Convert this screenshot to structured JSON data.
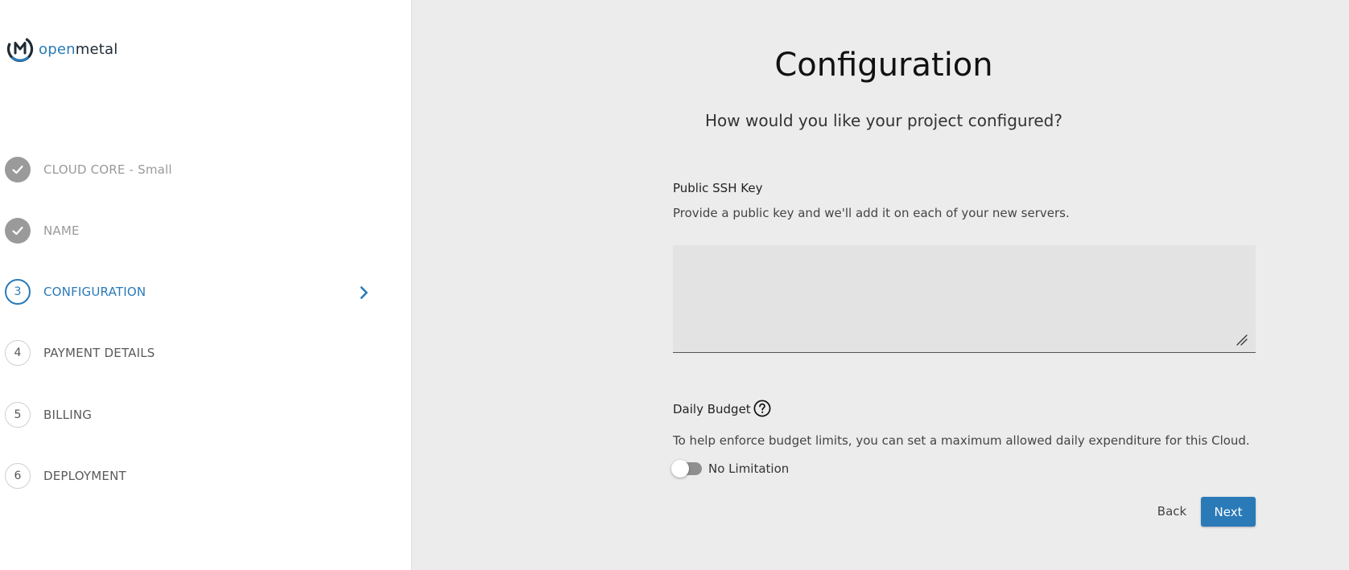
{
  "brand": {
    "logo_open": "open",
    "logo_metal": "metal",
    "accent_color": "#2a7ab8"
  },
  "steps": [
    {
      "number": "1",
      "label": "CLOUD CORE - Small",
      "state": "done",
      "icon": "check-icon"
    },
    {
      "number": "2",
      "label": "NAME",
      "state": "done",
      "icon": "check-icon"
    },
    {
      "number": "3",
      "label": "CONFIGURATION",
      "state": "active",
      "icon": "chevron-right-icon"
    },
    {
      "number": "4",
      "label": "PAYMENT DETAILS",
      "state": "pending"
    },
    {
      "number": "5",
      "label": "BILLING",
      "state": "pending"
    },
    {
      "number": "6",
      "label": "DEPLOYMENT",
      "state": "pending"
    }
  ],
  "main": {
    "title": "Configuration",
    "subtitle": "How would you like your project configured?",
    "ssh": {
      "label": "Public SSH Key",
      "description": "Provide a public key and we'll add it on each of your new servers.",
      "value": ""
    },
    "budget": {
      "label": "Daily Budget",
      "help_icon": "question-circle-icon",
      "description": "To help enforce budget limits, you can set a maximum allowed daily expenditure for this Cloud.",
      "toggle_label": "No Limitation",
      "toggle_on": false
    },
    "actions": {
      "back_label": "Back",
      "next_label": "Next"
    }
  }
}
